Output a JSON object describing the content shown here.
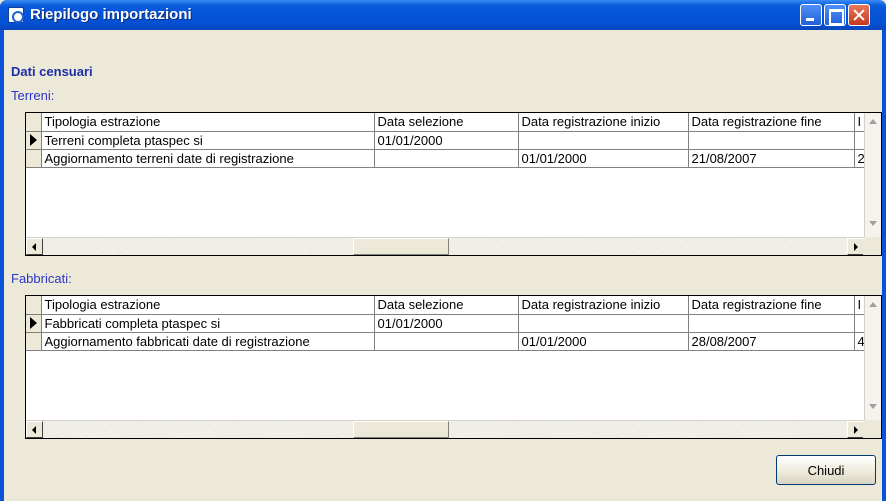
{
  "window": {
    "title": "Riepilogo importazioni"
  },
  "section_title": "Dati censuari",
  "terreni": {
    "label": "Terreni:",
    "columns": [
      "Tipologia estrazione",
      "Data selezione",
      "Data registrazione inizio",
      "Data registrazione fine",
      "I"
    ],
    "rows": [
      [
        "Terreni completa ptaspec si",
        "01/01/2000",
        "",
        "",
        ""
      ],
      [
        "Aggiornamento terreni  date di registrazione",
        "",
        "01/01/2000",
        "21/08/2007",
        "2"
      ]
    ]
  },
  "fabbricati": {
    "label": "Fabbricati:",
    "columns": [
      "Tipologia estrazione",
      "Data selezione",
      "Data registrazione inizio",
      "Data registrazione fine",
      "I"
    ],
    "rows": [
      [
        "Fabbricati completa ptaspec si",
        "01/01/2000",
        "",
        "",
        ""
      ],
      [
        "Aggiornamento fabbricati  date di registrazione",
        "",
        "01/01/2000",
        "28/08/2007",
        "4"
      ]
    ]
  },
  "buttons": {
    "close_label": "Chiudi"
  },
  "colors": {
    "titlebar": "#0552d6",
    "label_blue": "#2b37c4",
    "window_bg": "#ece9d8"
  },
  "icons": [
    "app-icon",
    "minimize-icon",
    "maximize-icon",
    "close-icon",
    "row-indicator-icon",
    "scroll-left-icon",
    "scroll-right-icon",
    "scroll-up-icon",
    "scroll-down-icon"
  ]
}
